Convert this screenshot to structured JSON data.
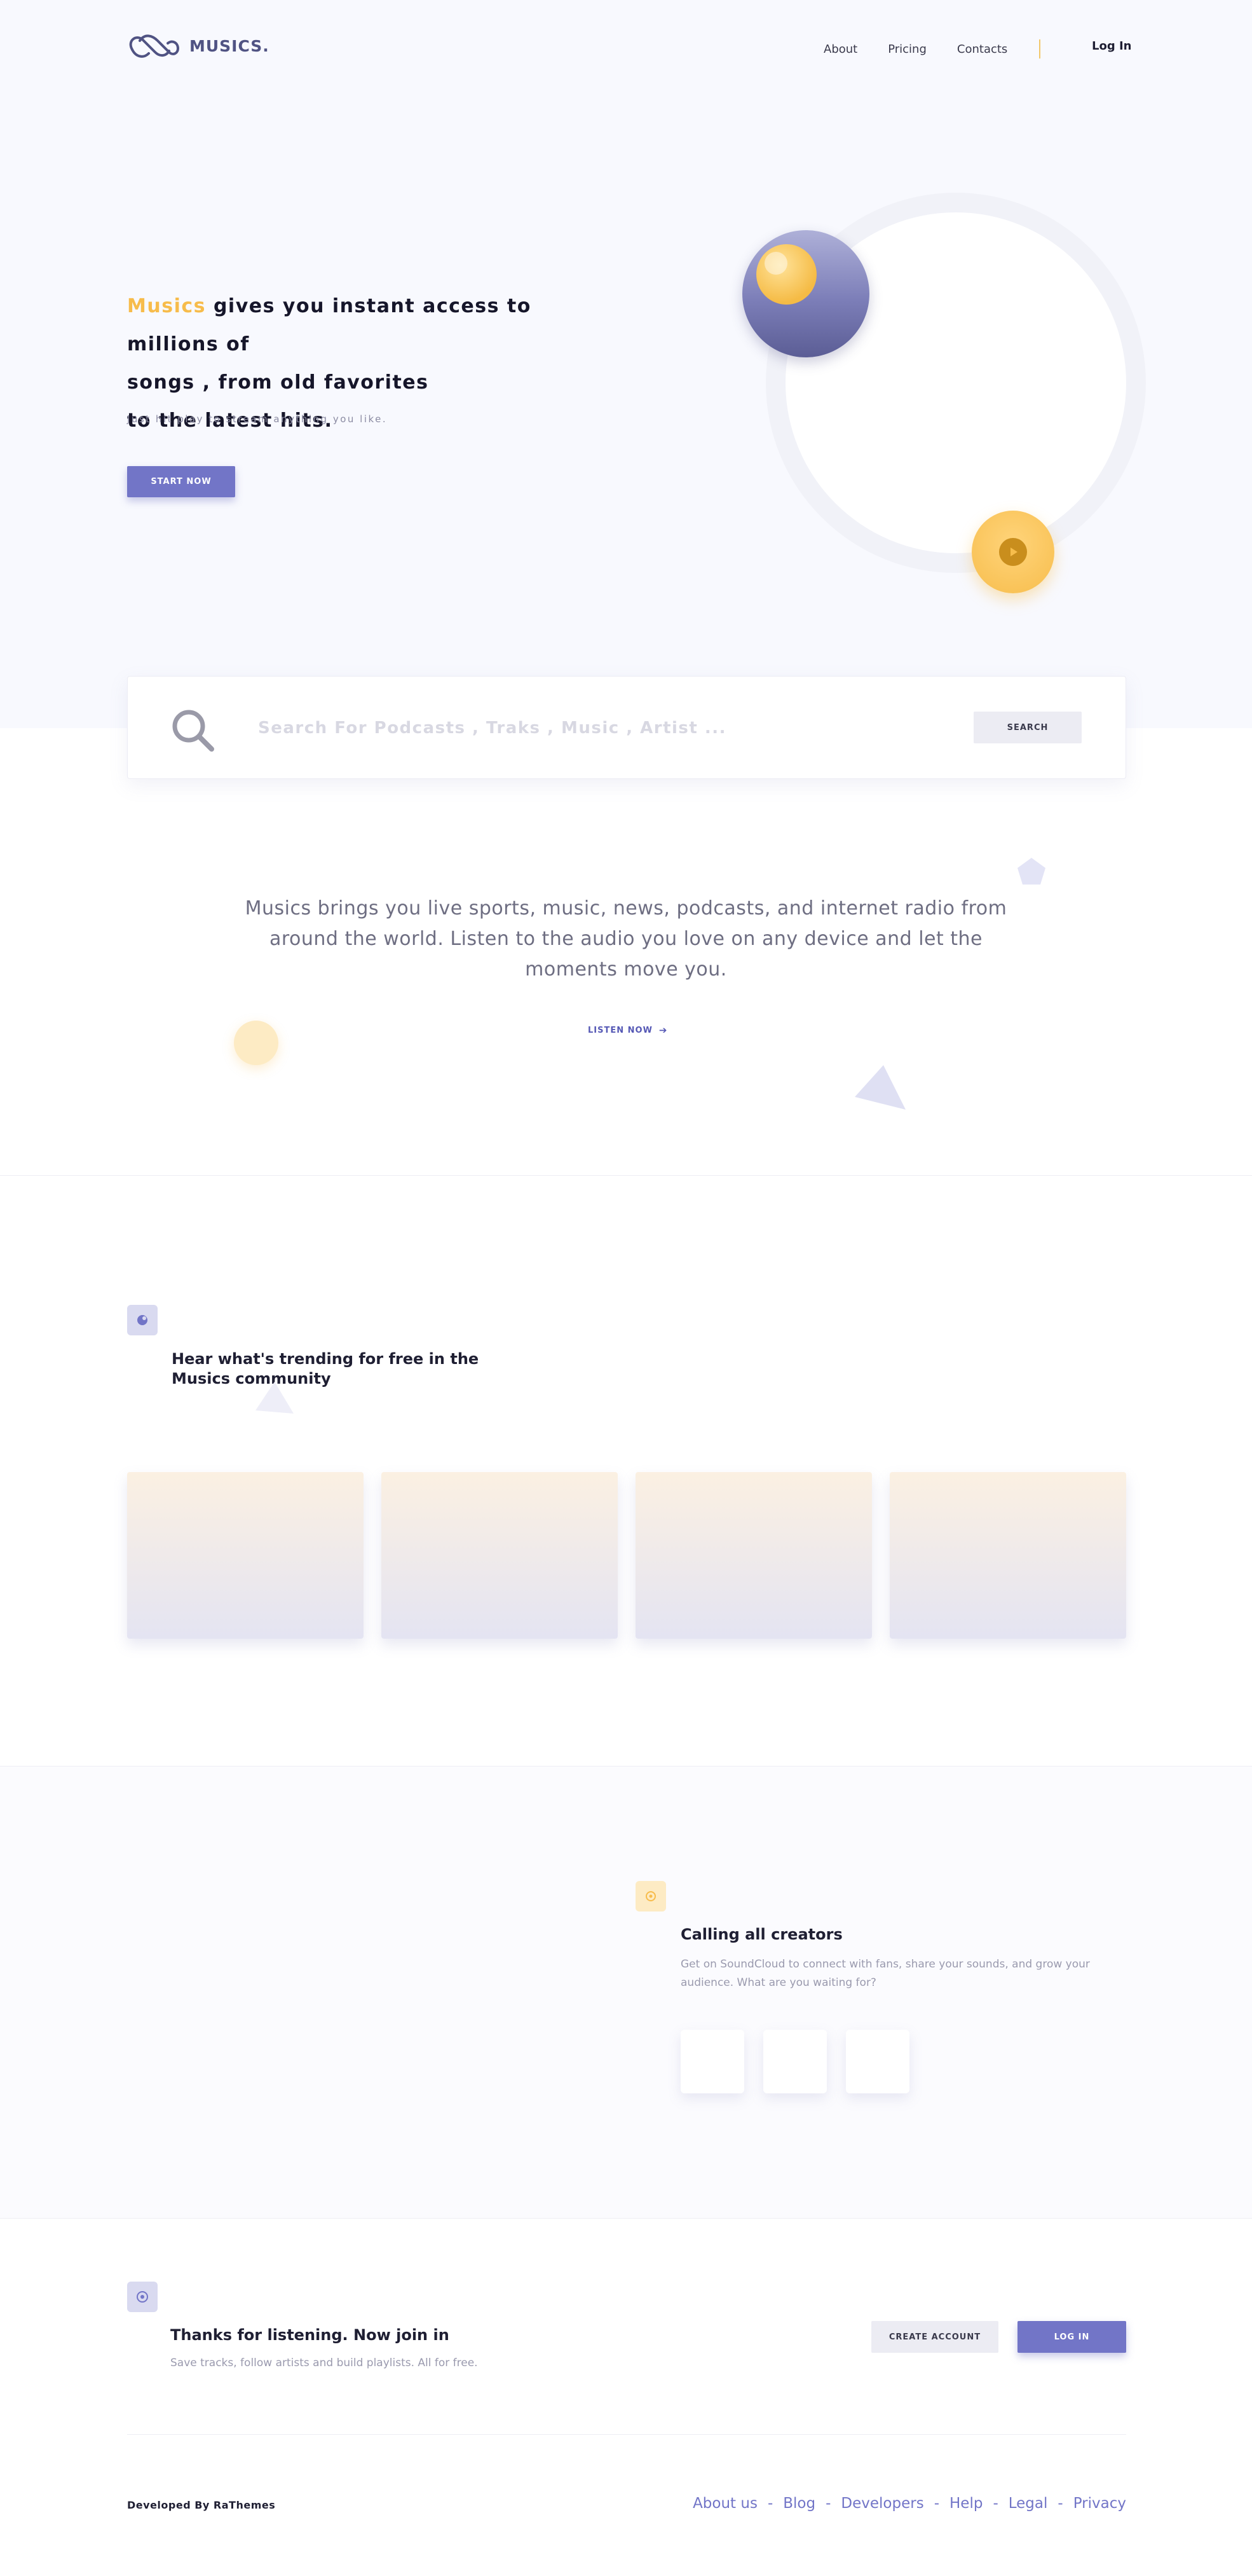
{
  "brand": {
    "name": "MUSICS.",
    "accent_color": "#7275c7",
    "highlight_color": "#f7bc4b"
  },
  "nav": {
    "items": [
      "About",
      "Pricing",
      "Contacts"
    ],
    "login": "Log In"
  },
  "hero": {
    "highlight": "Musics",
    "line1_rest": " gives you instant access to millions of",
    "line2": "songs , from old favorites",
    "line3": "to the latest hits.",
    "subtitle": "Just hit play to stream anything you like.",
    "cta": "START NOW"
  },
  "search": {
    "placeholder": "Search For Podcasts , Traks , Music , Artist ...",
    "button": "SEARCH",
    "icon": "search-icon"
  },
  "intro": {
    "text": "Musics brings you live sports, music, news, podcasts, and internet radio from around the world. Listen to the audio you love on any device and let the moments move you.",
    "link": "LISTEN NOW"
  },
  "trending": {
    "title": "Hear what's trending for free in the Musics community",
    "card_count": 4
  },
  "creators": {
    "title": "Calling all creators",
    "description": "Get on SoundCloud to connect with fans, share your sounds, and grow your audience. What are you waiting for?"
  },
  "join": {
    "title": "Thanks for listening. Now join in",
    "description": "Save tracks, follow artists and build playlists. All for free.",
    "create_account": "CREATE ACCOUNT",
    "login": "LOG IN"
  },
  "footer": {
    "developed_by": "Developed By RaThemes",
    "links": [
      "About us",
      "Blog",
      "Developers",
      "Help",
      "Legal",
      "Privacy"
    ]
  }
}
